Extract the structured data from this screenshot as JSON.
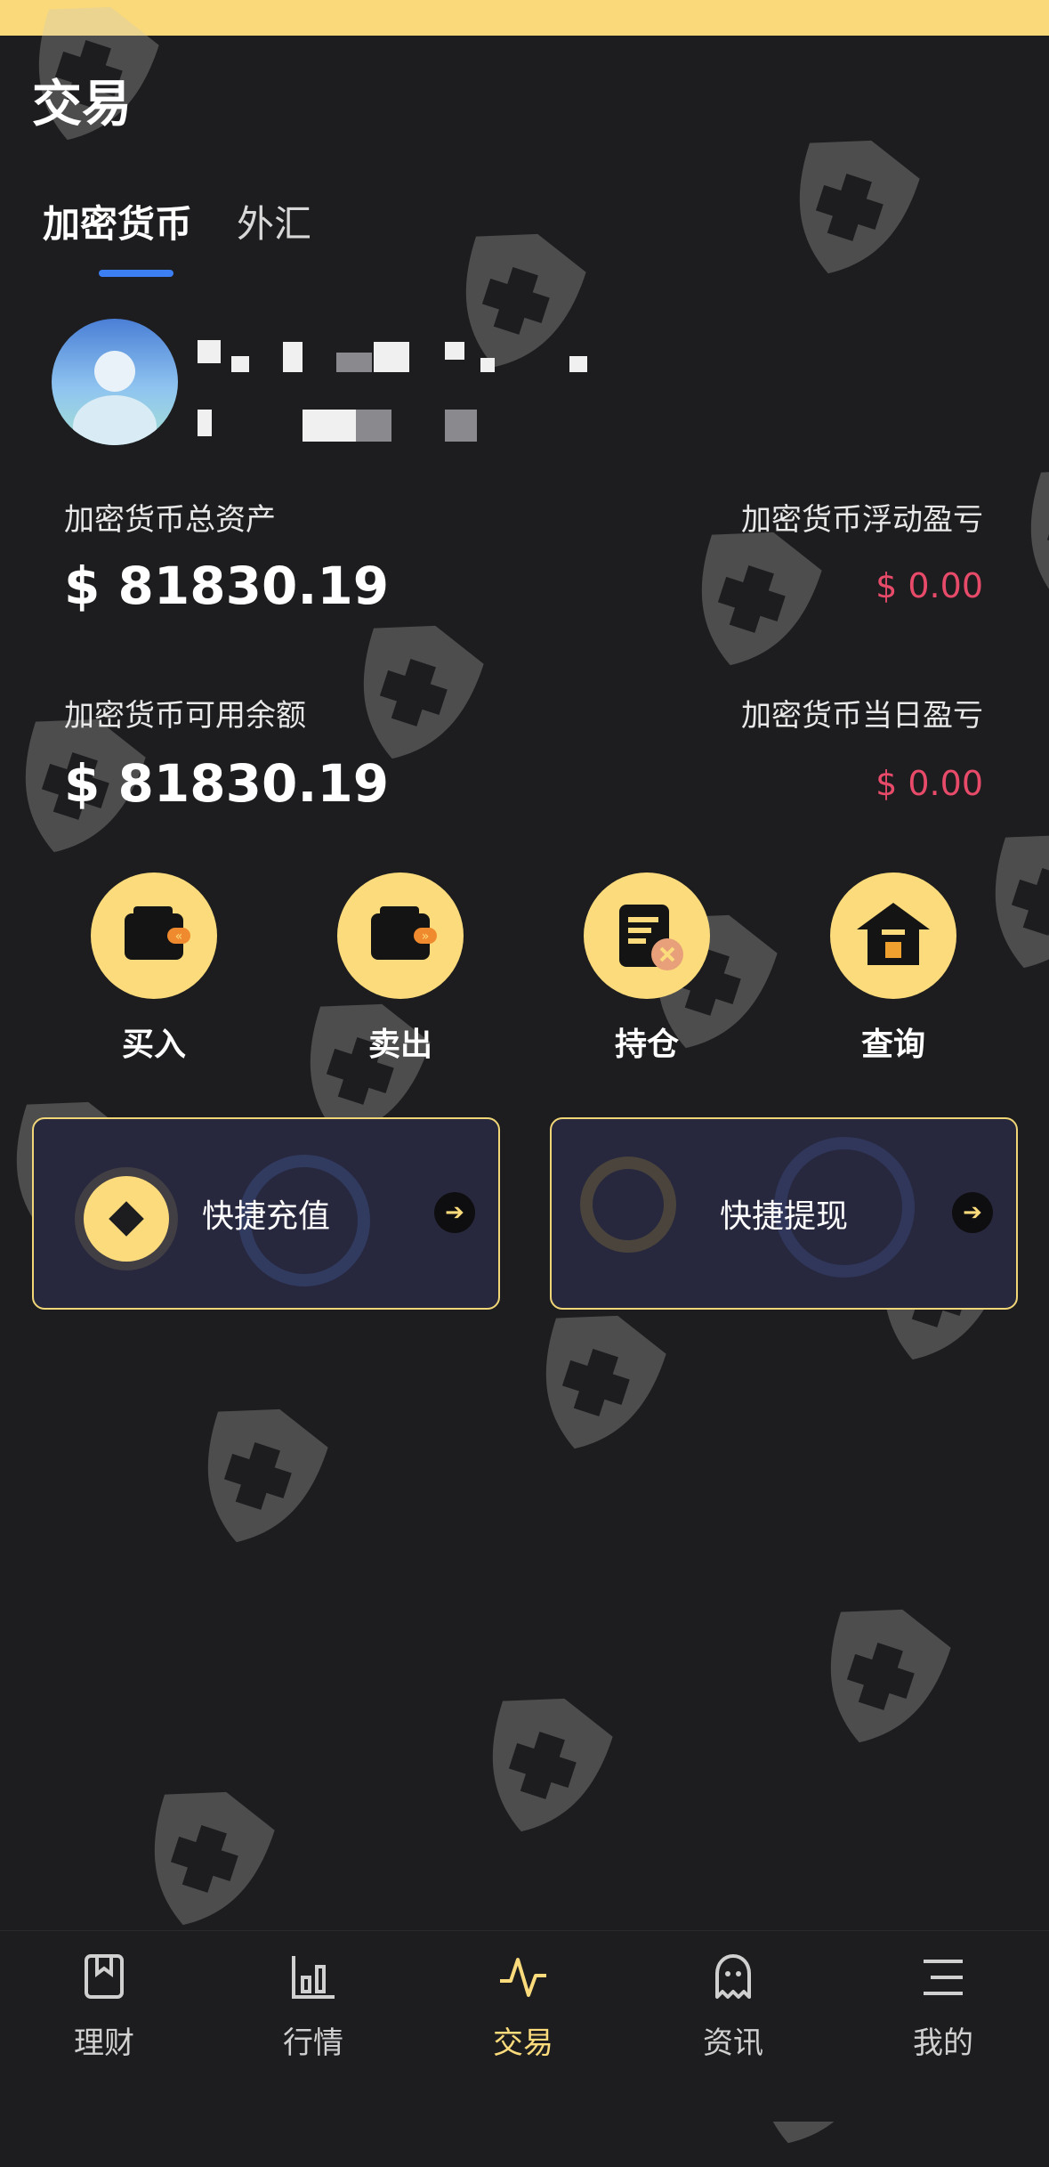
{
  "header": {
    "title": "交易"
  },
  "tabs": [
    {
      "label": "加密货币",
      "active": true
    },
    {
      "label": "外汇",
      "active": false
    }
  ],
  "account": {
    "total_assets_label": "加密货币总资产",
    "total_assets_value": "$ 81830.19",
    "floating_pnl_label": "加密货币浮动盈亏",
    "floating_pnl_value": "$ 0.00",
    "available_balance_label": "加密货币可用余额",
    "available_balance_value": "$ 81830.19",
    "daily_pnl_label": "加密货币当日盈亏",
    "daily_pnl_value": "$ 0.00"
  },
  "actions": [
    {
      "label": "买入",
      "icon": "wallet-buy-icon"
    },
    {
      "label": "卖出",
      "icon": "wallet-sell-icon"
    },
    {
      "label": "持仓",
      "icon": "position-document-icon"
    },
    {
      "label": "查询",
      "icon": "house-query-icon"
    }
  ],
  "quick": [
    {
      "label": "快捷充值",
      "icon": "coin-deposit-icon"
    },
    {
      "label": "快捷提现",
      "icon": "coin-withdraw-icon"
    }
  ],
  "bottom_nav": [
    {
      "label": "理财",
      "icon": "bookmark-icon",
      "active": false
    },
    {
      "label": "行情",
      "icon": "bar-chart-icon",
      "active": false
    },
    {
      "label": "交易",
      "icon": "pulse-icon",
      "active": true
    },
    {
      "label": "资讯",
      "icon": "ghost-icon",
      "active": false
    },
    {
      "label": "我的",
      "icon": "menu-icon",
      "active": false
    }
  ],
  "colors": {
    "background": "#1d1d1f",
    "accent_yellow": "#fbdb7b",
    "tab_indicator": "#3b7ff2",
    "pnl_red": "#e84a6a",
    "top_bar": "#fad97a"
  }
}
